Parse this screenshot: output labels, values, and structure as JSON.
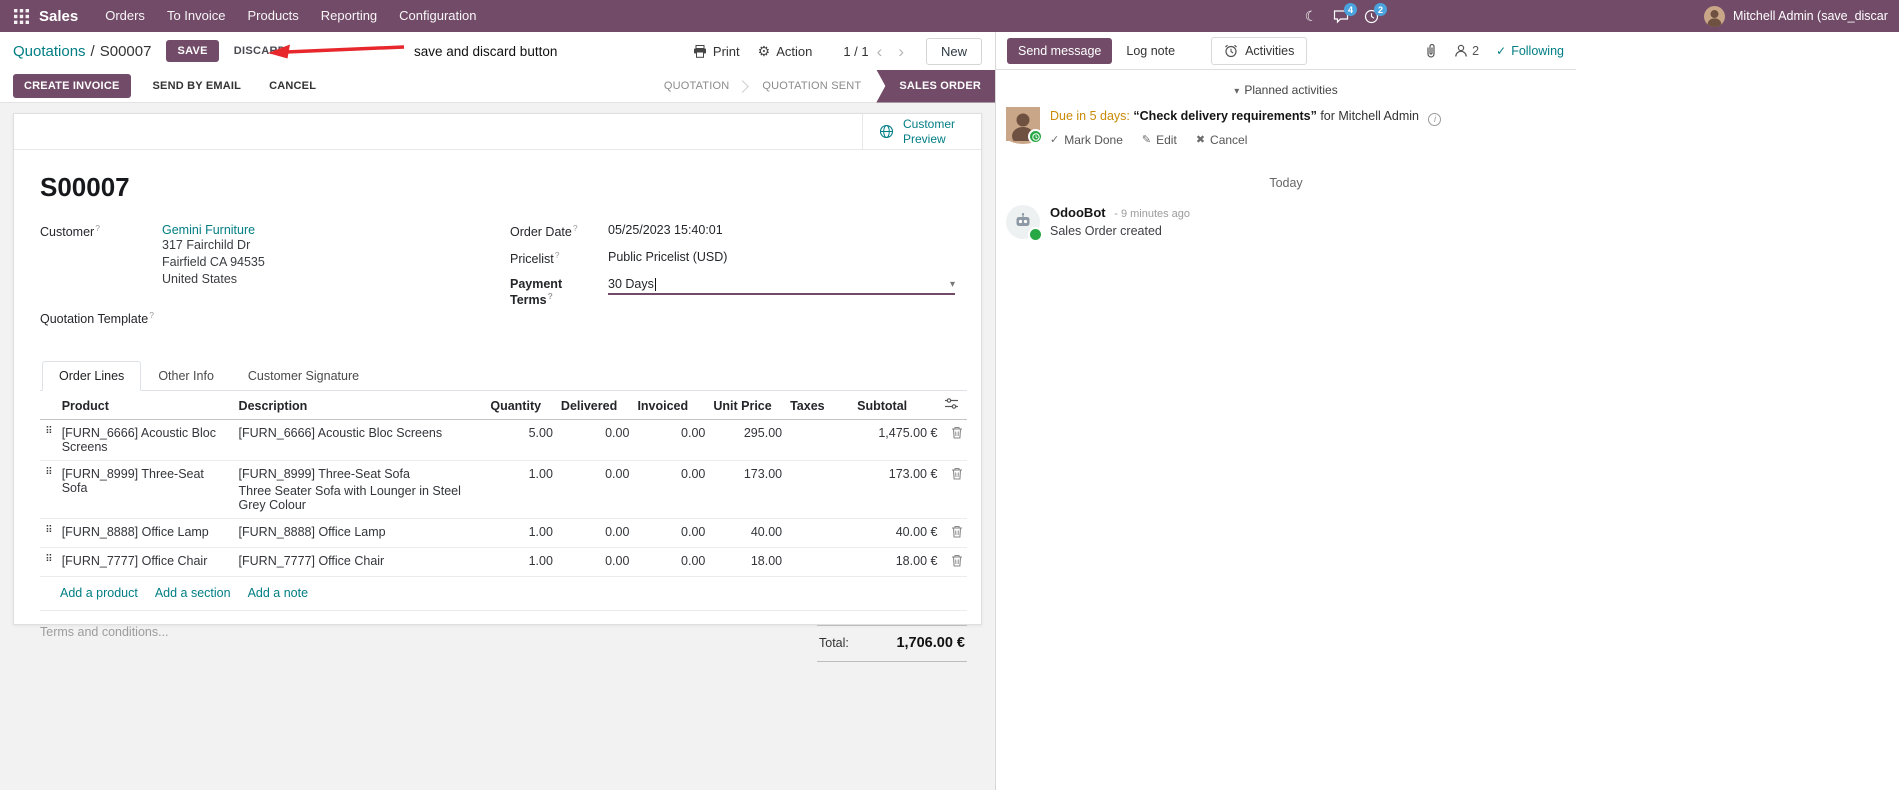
{
  "colors": {
    "primary": "#714B67",
    "link": "#017E84",
    "edited_value": "#1b6ce8",
    "due_text": "#c98a06",
    "annotation_arrow": "#e8272c",
    "active_state_bg": "#714B67",
    "badge_bg": "#4aa3df"
  },
  "icons": {
    "moon": "☾",
    "gear": "⚙",
    "chevron_left": "‹",
    "chevron_right": "›",
    "caret_down": "▾",
    "collapse_caret": "▾",
    "check": "✓",
    "pencil": "✎",
    "cross": "✖",
    "info": "i",
    "drag": "⠿"
  },
  "topbar": {
    "app_name": "Sales",
    "menus": [
      "Orders",
      "To Invoice",
      "Products",
      "Reporting",
      "Configuration"
    ],
    "messages_badge": "4",
    "activities_badge": "2",
    "user_name": "Mitchell Admin (save_discar"
  },
  "control_panel": {
    "breadcrumb_parent": "Quotations",
    "breadcrumb_separator": "/",
    "breadcrumb_current": "S00007",
    "save": "SAVE",
    "discard": "DISCARD",
    "print": "Print",
    "action": "Action",
    "pager": "1 / 1",
    "new": "New"
  },
  "annotation": {
    "label": "save and discard button"
  },
  "statusbar": {
    "actions": [
      "CREATE INVOICE",
      "SEND BY EMAIL",
      "CANCEL"
    ],
    "states": [
      "QUOTATION",
      "QUOTATION SENT",
      "SALES ORDER"
    ],
    "active_state": "SALES ORDER"
  },
  "sheet": {
    "preview_button": "Customer Preview",
    "title": "S00007",
    "fields": {
      "help_marker": "?",
      "customer_label": "Customer",
      "customer_name": "Gemini Furniture",
      "address_line1": "317 Fairchild Dr",
      "address_line2": "Fairfield CA 94535",
      "address_line3": "United States",
      "quotation_template_label": "Quotation Template",
      "order_date_label": "Order Date",
      "order_date": "05/25/2023 15:40:01",
      "pricelist_label": "Pricelist",
      "pricelist": "Public Pricelist (USD)",
      "payment_terms_label": "Payment Terms",
      "payment_terms": "30 Days"
    },
    "tabs": [
      "Order Lines",
      "Other Info",
      "Customer Signature"
    ],
    "order_lines": {
      "columns": [
        "Product",
        "Description",
        "Quantity",
        "Delivered",
        "Invoiced",
        "Unit Price",
        "Taxes",
        "Subtotal"
      ],
      "rows": [
        {
          "product": "[FURN_6666] Acoustic Bloc Screens",
          "description": "[FURN_6666] Acoustic Bloc Screens",
          "description2": "",
          "quantity": "5.00",
          "delivered": "0.00",
          "invoiced": "0.00",
          "unit_price": "295.00",
          "taxes": "",
          "subtotal": "1,475.00 €"
        },
        {
          "product": "[FURN_8999] Three-Seat Sofa",
          "description": "[FURN_8999] Three-Seat Sofa",
          "description2": "Three Seater Sofa with Lounger in Steel Grey Colour",
          "quantity": "1.00",
          "delivered": "0.00",
          "invoiced": "0.00",
          "unit_price": "173.00",
          "taxes": "",
          "subtotal": "173.00 €"
        },
        {
          "product": "[FURN_8888] Office Lamp",
          "description": "[FURN_8888] Office Lamp",
          "description2": "",
          "quantity": "1.00",
          "delivered": "0.00",
          "invoiced": "0.00",
          "unit_price": "40.00",
          "taxes": "",
          "subtotal": "40.00 €"
        },
        {
          "product": "[FURN_7777] Office Chair",
          "description": "[FURN_7777] Office Chair",
          "description2": "",
          "quantity": "1.00",
          "delivered": "0.00",
          "invoiced": "0.00",
          "unit_price": "18.00",
          "taxes": "",
          "subtotal": "18.00 €"
        }
      ],
      "add_product": "Add a product",
      "add_section": "Add a section",
      "add_note": "Add a note",
      "terms_placeholder": "Terms and conditions...",
      "total_label": "Total:",
      "total_value": "1,706.00 €"
    }
  },
  "chatter": {
    "send_message": "Send message",
    "log_note": "Log note",
    "activities_tab": "Activities",
    "followers_count": "2",
    "following": "Following",
    "planned_activities": "Planned activities",
    "activity": {
      "due": "Due in 5 days:",
      "summary": "“Check delivery requirements”",
      "assignee": "for Mitchell Admin",
      "mark_done": "Mark Done",
      "edit": "Edit",
      "cancel": "Cancel"
    },
    "date_separator": "Today",
    "message": {
      "author": "OdooBot",
      "time": "- 9 minutes ago",
      "body": "Sales Order created"
    }
  }
}
